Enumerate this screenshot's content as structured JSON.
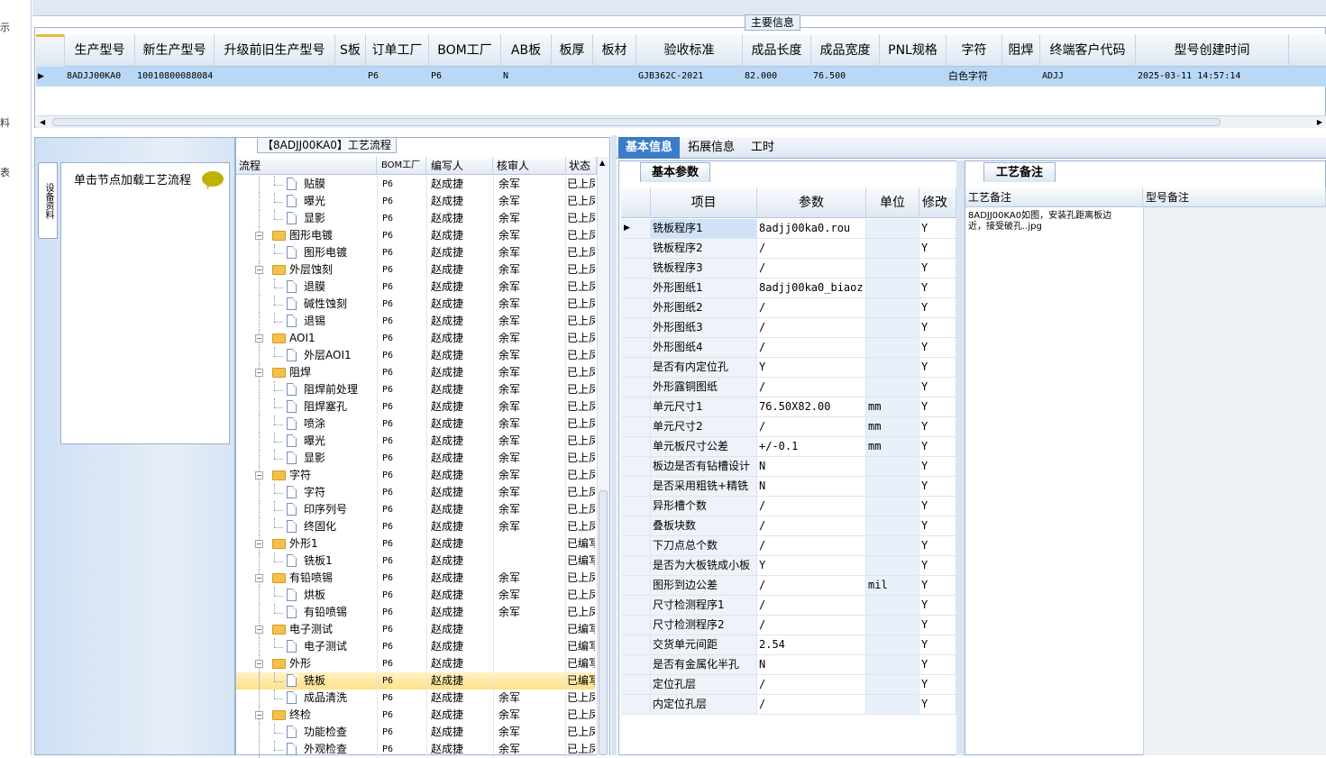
{
  "left_edge_glyphs": [
    "示",
    "料",
    "表"
  ],
  "main": {
    "legend": "主要信息",
    "columns": [
      "生产型号",
      "新生产型号",
      "升级前旧生产型号",
      "S板",
      "订单工厂",
      "BOM工厂",
      "AB板",
      "板厚",
      "板材",
      "验收标准",
      "成品长度",
      "成品宽度",
      "PNL规格",
      "字符",
      "阻焊",
      "终端客户代码",
      "型号创建时间"
    ],
    "row": [
      "8ADJJ00KA0",
      "10010800088084",
      "",
      "",
      "P6",
      "P6",
      "N",
      "",
      "",
      "GJB362C-2021",
      "82.000",
      "76.500",
      "",
      "白色字符",
      "",
      "ADJJ",
      "2025-03-11 14:57:14"
    ],
    "row_indicator": "▶",
    "scroll_left": "◀",
    "scroll_right": "▶"
  },
  "left_panel": {
    "vertical_tab": "设备资料",
    "note_title": "单击节点加载工艺流程"
  },
  "tree": {
    "legend": "【8ADJJ00KA0】工艺流程",
    "columns": [
      "流程",
      "BOM工厂",
      "编写人",
      "核审人",
      "状态"
    ],
    "rows": [
      {
        "level": 2,
        "name": "贴膜",
        "bom": "P6",
        "writer": "赵成捷",
        "reviewer": "余军",
        "status": "已上凤"
      },
      {
        "level": 2,
        "name": "曝光",
        "bom": "P6",
        "writer": "赵成捷",
        "reviewer": "余军",
        "status": "已上凤"
      },
      {
        "level": 2,
        "name": "显影",
        "bom": "P6",
        "writer": "赵成捷",
        "reviewer": "余军",
        "status": "已上凤"
      },
      {
        "level": 1,
        "name": "图形电镀",
        "bom": "P6",
        "writer": "赵成捷",
        "reviewer": "余军",
        "status": "已上凤"
      },
      {
        "level": 2,
        "name": "图形电镀",
        "bom": "P6",
        "writer": "赵成捷",
        "reviewer": "余军",
        "status": "已上凤"
      },
      {
        "level": 1,
        "name": "外层蚀刻",
        "bom": "P6",
        "writer": "赵成捷",
        "reviewer": "余军",
        "status": "已上凤"
      },
      {
        "level": 2,
        "name": "退膜",
        "bom": "P6",
        "writer": "赵成捷",
        "reviewer": "余军",
        "status": "已上凤"
      },
      {
        "level": 2,
        "name": "碱性蚀刻",
        "bom": "P6",
        "writer": "赵成捷",
        "reviewer": "余军",
        "status": "已上凤"
      },
      {
        "level": 2,
        "name": "退锡",
        "bom": "P6",
        "writer": "赵成捷",
        "reviewer": "余军",
        "status": "已上凤"
      },
      {
        "level": 1,
        "name": "AOI1",
        "bom": "P6",
        "writer": "赵成捷",
        "reviewer": "余军",
        "status": "已上凤"
      },
      {
        "level": 2,
        "name": "外层AOI1",
        "bom": "P6",
        "writer": "赵成捷",
        "reviewer": "余军",
        "status": "已上凤"
      },
      {
        "level": 1,
        "name": "阻焊",
        "bom": "P6",
        "writer": "赵成捷",
        "reviewer": "余军",
        "status": "已上凤"
      },
      {
        "level": 2,
        "name": "阻焊前处理",
        "bom": "P6",
        "writer": "赵成捷",
        "reviewer": "余军",
        "status": "已上凤"
      },
      {
        "level": 2,
        "name": "阻焊塞孔",
        "bom": "P6",
        "writer": "赵成捷",
        "reviewer": "余军",
        "status": "已上凤"
      },
      {
        "level": 2,
        "name": "喷涂",
        "bom": "P6",
        "writer": "赵成捷",
        "reviewer": "余军",
        "status": "已上凤"
      },
      {
        "level": 2,
        "name": "曝光",
        "bom": "P6",
        "writer": "赵成捷",
        "reviewer": "余军",
        "status": "已上凤"
      },
      {
        "level": 2,
        "name": "显影",
        "bom": "P6",
        "writer": "赵成捷",
        "reviewer": "余军",
        "status": "已上凤"
      },
      {
        "level": 1,
        "name": "字符",
        "bom": "P6",
        "writer": "赵成捷",
        "reviewer": "余军",
        "status": "已上凤"
      },
      {
        "level": 2,
        "name": "字符",
        "bom": "P6",
        "writer": "赵成捷",
        "reviewer": "余军",
        "status": "已上凤"
      },
      {
        "level": 2,
        "name": "印序列号",
        "bom": "P6",
        "writer": "赵成捷",
        "reviewer": "余军",
        "status": "已上凤"
      },
      {
        "level": 2,
        "name": "终固化",
        "bom": "P6",
        "writer": "赵成捷",
        "reviewer": "余军",
        "status": "已上凤"
      },
      {
        "level": 1,
        "name": "外形1",
        "bom": "P6",
        "writer": "赵成捷",
        "reviewer": "",
        "status": "已编写"
      },
      {
        "level": 2,
        "name": "铣板1",
        "bom": "P6",
        "writer": "赵成捷",
        "reviewer": "",
        "status": "已编写"
      },
      {
        "level": 1,
        "name": "有铅喷锡",
        "bom": "P6",
        "writer": "赵成捷",
        "reviewer": "余军",
        "status": "已上凤"
      },
      {
        "level": 2,
        "name": "烘板",
        "bom": "P6",
        "writer": "赵成捷",
        "reviewer": "余军",
        "status": "已上凤"
      },
      {
        "level": 2,
        "name": "有铅喷锡",
        "bom": "P6",
        "writer": "赵成捷",
        "reviewer": "余军",
        "status": "已上凤"
      },
      {
        "level": 1,
        "name": "电子测试",
        "bom": "P6",
        "writer": "赵成捷",
        "reviewer": "",
        "status": "已编写"
      },
      {
        "level": 2,
        "name": "电子测试",
        "bom": "P6",
        "writer": "赵成捷",
        "reviewer": "",
        "status": "已编写"
      },
      {
        "level": 1,
        "name": "外形",
        "bom": "P6",
        "writer": "赵成捷",
        "reviewer": "",
        "status": "已编写"
      },
      {
        "level": 2,
        "name": "铣板",
        "bom": "P6",
        "writer": "赵成捷",
        "reviewer": "",
        "status": "已编写",
        "selected": true
      },
      {
        "level": 2,
        "name": "成品清洗",
        "bom": "P6",
        "writer": "赵成捷",
        "reviewer": "余军",
        "status": "已上凤"
      },
      {
        "level": 1,
        "name": "终检",
        "bom": "P6",
        "writer": "赵成捷",
        "reviewer": "余军",
        "status": "已上凤"
      },
      {
        "level": 2,
        "name": "功能检查",
        "bom": "P6",
        "writer": "赵成捷",
        "reviewer": "余军",
        "status": "已上凤"
      },
      {
        "level": 2,
        "name": "外观检查",
        "bom": "P6",
        "writer": "赵成捷",
        "reviewer": "余军",
        "status": "已上凤"
      }
    ]
  },
  "tabs": [
    "基本信息",
    "拓展信息",
    "工时"
  ],
  "basic": {
    "title": "基本参数",
    "columns": [
      "项目",
      "参数",
      "单位",
      "修改"
    ],
    "rows": [
      [
        "铣板程序1",
        "8adjj00ka0.rou",
        "",
        "Y"
      ],
      [
        "铣板程序2",
        "/",
        "",
        "Y"
      ],
      [
        "铣板程序3",
        "/",
        "",
        "Y"
      ],
      [
        "外形图纸1",
        "8adjj00ka0_biaoz...",
        "",
        "Y"
      ],
      [
        "外形图纸2",
        "/",
        "",
        "Y"
      ],
      [
        "外形图纸3",
        "/",
        "",
        "Y"
      ],
      [
        "外形图纸4",
        "/",
        "",
        "Y"
      ],
      [
        "是否有内定位孔",
        "Y",
        "",
        "Y"
      ],
      [
        "外形露铜图纸",
        "/",
        "",
        "Y"
      ],
      [
        "单元尺寸1",
        "76.50X82.00",
        "mm",
        "Y"
      ],
      [
        "单元尺寸2",
        "/",
        "mm",
        "Y"
      ],
      [
        "单元板尺寸公差",
        "+/-0.1",
        "mm",
        "Y"
      ],
      [
        "板边是否有钻槽设计",
        "N",
        "",
        "Y"
      ],
      [
        "是否采用粗铣+精铣",
        "N",
        "",
        "Y"
      ],
      [
        "异形槽个数",
        "/",
        "",
        "Y"
      ],
      [
        "叠板块数",
        "/",
        "",
        "Y"
      ],
      [
        "下刀点总个数",
        "/",
        "",
        "Y"
      ],
      [
        "是否为大板铣成小板",
        "Y",
        "",
        "Y"
      ],
      [
        "图形到边公差",
        "/",
        "mil",
        "Y"
      ],
      [
        "尺寸检测程序1",
        "/",
        "",
        "Y"
      ],
      [
        "尺寸检测程序2",
        "/",
        "",
        "Y"
      ],
      [
        "交货单元间距",
        "2.54",
        "",
        "Y"
      ],
      [
        "是否有金属化半孔",
        "N",
        "",
        "Y"
      ],
      [
        "定位孔层",
        "/",
        "",
        "Y"
      ],
      [
        "内定位孔层",
        "/",
        "",
        "Y"
      ]
    ]
  },
  "notes": {
    "tab": "工艺备注",
    "columns": [
      "工艺备注",
      "型号备注"
    ],
    "text": "8ADJJ00KA0如图，安装孔距离板边近，接受破孔..jpg"
  }
}
